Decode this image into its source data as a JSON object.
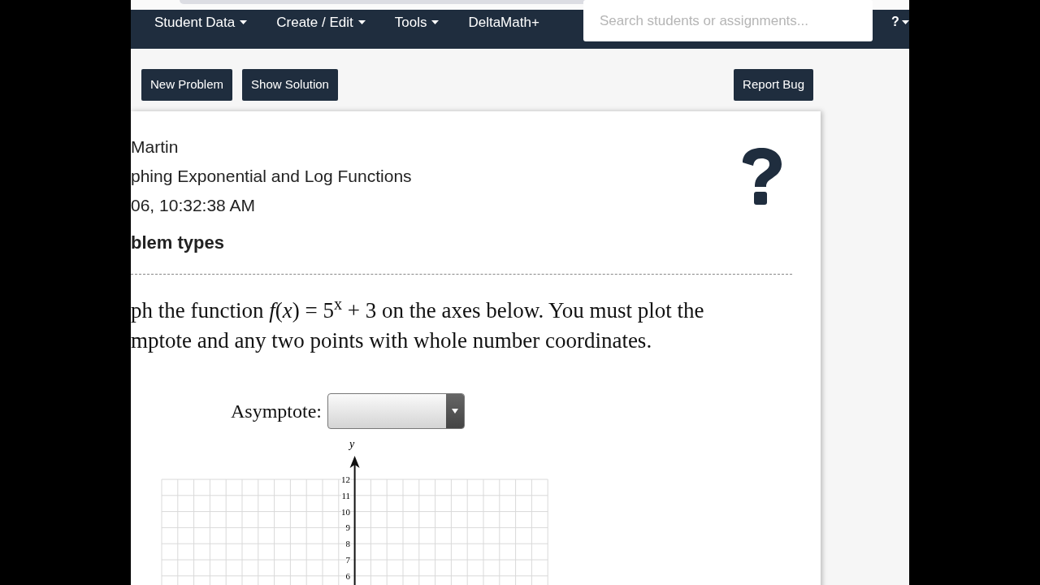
{
  "nav": {
    "items": [
      {
        "label": "Student Data",
        "dropdown": true
      },
      {
        "label": "Create / Edit",
        "dropdown": true
      },
      {
        "label": "Tools",
        "dropdown": true
      },
      {
        "label": "DeltaMath+",
        "dropdown": false
      }
    ],
    "search": {
      "placeholder": "Search students or assignments..."
    },
    "help": {
      "label": "?",
      "dropdown": true
    }
  },
  "toolbar": {
    "left_buttons": [
      "New Problem",
      "Show Solution"
    ],
    "right_buttons": [
      "Report Bug"
    ]
  },
  "header": {
    "lines": [
      "Martin",
      "phing Exponential and Log Functions",
      "06, 10:32:38 AM"
    ],
    "subtitle": "blem types"
  },
  "question": {
    "lines": [
      "ph the function *f*(*x*) = 5$^{x}$ + 3 on the axes below. You must plot the",
      "mptote and any two points with whole number coordinates."
    ]
  },
  "asymptote": {
    "label": "Asymptote:"
  },
  "graph": {
    "y_axis_label": "y",
    "y_tick_labels": [
      "12",
      "11",
      "10",
      "9",
      "8",
      "7",
      "6"
    ]
  }
}
